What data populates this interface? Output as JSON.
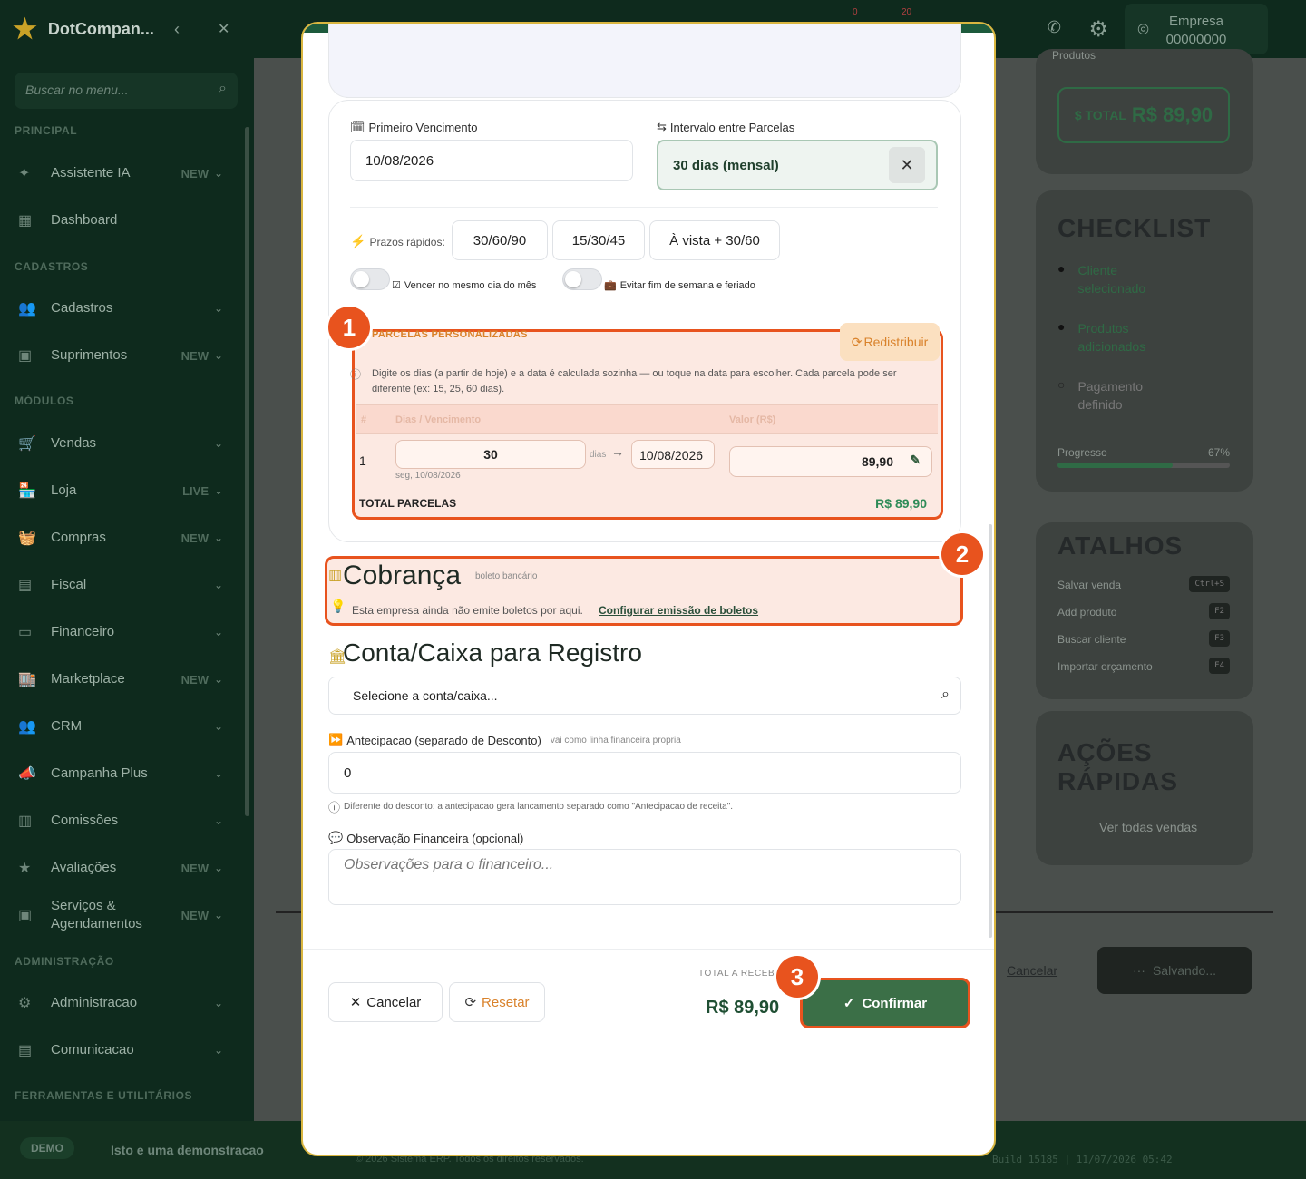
{
  "sidebar": {
    "brand": "DotCompan...",
    "search_placeholder": "Buscar no menu...",
    "sections": [
      "PRINCIPAL",
      "CADASTROS",
      "MÓDULOS",
      "ADMINISTRAÇÃO",
      "FERRAMENTAS E UTILITÁRIOS"
    ],
    "items": [
      {
        "label": "Assistente IA",
        "badge": "NEW",
        "icon": "sparkle-icon"
      },
      {
        "label": "Dashboard",
        "badge": "",
        "icon": "dashboard-icon"
      },
      {
        "label": "Cadastros",
        "badge": "",
        "icon": "users-icon"
      },
      {
        "label": "Suprimentos",
        "badge": "NEW",
        "icon": "box-icon"
      },
      {
        "label": "Vendas",
        "badge": "",
        "icon": "cart-icon"
      },
      {
        "label": "Loja",
        "badge": "LIVE",
        "icon": "store-icon"
      },
      {
        "label": "Compras",
        "badge": "NEW",
        "icon": "basket-icon"
      },
      {
        "label": "Fiscal",
        "badge": "",
        "icon": "document-icon"
      },
      {
        "label": "Financeiro",
        "badge": "",
        "icon": "money-icon"
      },
      {
        "label": "Marketplace",
        "badge": "NEW",
        "icon": "marketplace-icon"
      },
      {
        "label": "CRM",
        "badge": "",
        "icon": "crm-icon"
      },
      {
        "label": "Campanha Plus",
        "badge": "",
        "icon": "megaphone-icon"
      },
      {
        "label": "Comissões",
        "badge": "",
        "icon": "commission-icon"
      },
      {
        "label": "Avaliações",
        "badge": "NEW",
        "icon": "star-icon"
      },
      {
        "label": "Serviços & Agendamentos",
        "badge": "NEW",
        "icon": "calendar-icon"
      },
      {
        "label": "Administracao",
        "badge": "",
        "icon": "gear-icon"
      },
      {
        "label": "Comunicacao",
        "badge": "",
        "icon": "chat-icon"
      }
    ]
  },
  "topbar": {
    "company_label": "Empresa",
    "company_code": "00000000",
    "counter_a": "0",
    "counter_b": "20"
  },
  "right_panel": {
    "products_label": "Produtos",
    "total_label": "$ TOTAL",
    "total_value": "R$ 89,90",
    "checklist_title": "CHECKLIST",
    "checklist": [
      "Cliente selecionado",
      "Produtos adicionados",
      "Pagamento definido"
    ],
    "progress_label": "Progresso",
    "progress_value": "67%",
    "progress_fraction": 0.67,
    "shortcuts_title": "ATALHOS",
    "shortcuts": [
      {
        "label": "Salvar venda",
        "key": "Ctrl+S"
      },
      {
        "label": "Add produto",
        "key": "F2"
      },
      {
        "label": "Buscar cliente",
        "key": "F3"
      },
      {
        "label": "Importar orçamento",
        "key": "F4"
      }
    ],
    "quick_actions_title": "AÇÕES RÁPIDAS",
    "see_all_sales": "Ver todas vendas",
    "cancel_label": "Cancelar",
    "saving_label": "Salvando..."
  },
  "footer": {
    "demo_badge": "DEMO",
    "demo_text": "Isto e uma demonstracao",
    "copyright": "© 2026 Sistema ERP. Todos os direitos reservados.",
    "build": "Build 15185 | 11/07/2026 05:42"
  },
  "modal": {
    "first_due_label": "Primeiro Vencimento",
    "first_due_value": "10/08/2026",
    "interval_label": "Intervalo entre Parcelas",
    "interval_value": "30 dias (mensal)",
    "quick_terms_label": "Prazos rápidos:",
    "quick_terms": [
      "30/60/90",
      "15/30/45",
      "À vista + 30/60"
    ],
    "toggle_same_day": "Vencer no mesmo dia do mês",
    "toggle_avoid_weekend": "Evitar fim de semana e feriado",
    "custom_title": "PARCELAS PERSONALIZADAS",
    "redistribute": "Redistribuir",
    "custom_help": "Digite os dias (a partir de hoje) e a data é calculada sozinha — ou toque na data para escolher. Cada parcela pode ser diferente (ex: 15, 25, 60 dias).",
    "table_headers": [
      "#",
      "Dias / Vencimento",
      "Valor (R$)"
    ],
    "installments": [
      {
        "n": "1",
        "days": "30",
        "days_unit": "dias",
        "date": "10/08/2026",
        "weekday_date": "seg, 10/08/2026",
        "value": "89,90"
      }
    ],
    "total_installments_label": "TOTAL PARCELAS",
    "total_installments_value": "R$ 89,90",
    "billing_title": "Cobrança",
    "billing_subtitle": "boleto bancário",
    "billing_note": "Esta empresa ainda não emite boletos por aqui.",
    "billing_link": "Configurar emissão de boletos",
    "account_title": "Conta/Caixa para Registro",
    "account_placeholder": "Selecione a conta/caixa...",
    "anticipation_label": "Antecipacao (separado de Desconto)",
    "anticipation_hint": "vai como linha financeira propria",
    "anticipation_value": "0",
    "anticipation_note": "Diferente do desconto: a antecipacao gera lancamento separado como \"Antecipacao de receita\".",
    "obs_label": "Observação Financeira (opcional)",
    "obs_placeholder": "Observações para o financeiro...",
    "cancel": "Cancelar",
    "reset": "Resetar",
    "total_receive_label": "TOTAL A RECEBER",
    "total_receive_value": "R$ 89,90",
    "confirm": "Confirmar"
  },
  "annotations": [
    "1",
    "2",
    "3"
  ],
  "colors": {
    "brand_green": "#1d5a3c",
    "confirm_green": "#3b6f47",
    "highlight": "#e8531e",
    "value_green": "#2e8b57",
    "reset_orange": "#d9822b",
    "modal_border": "#d9b640"
  }
}
